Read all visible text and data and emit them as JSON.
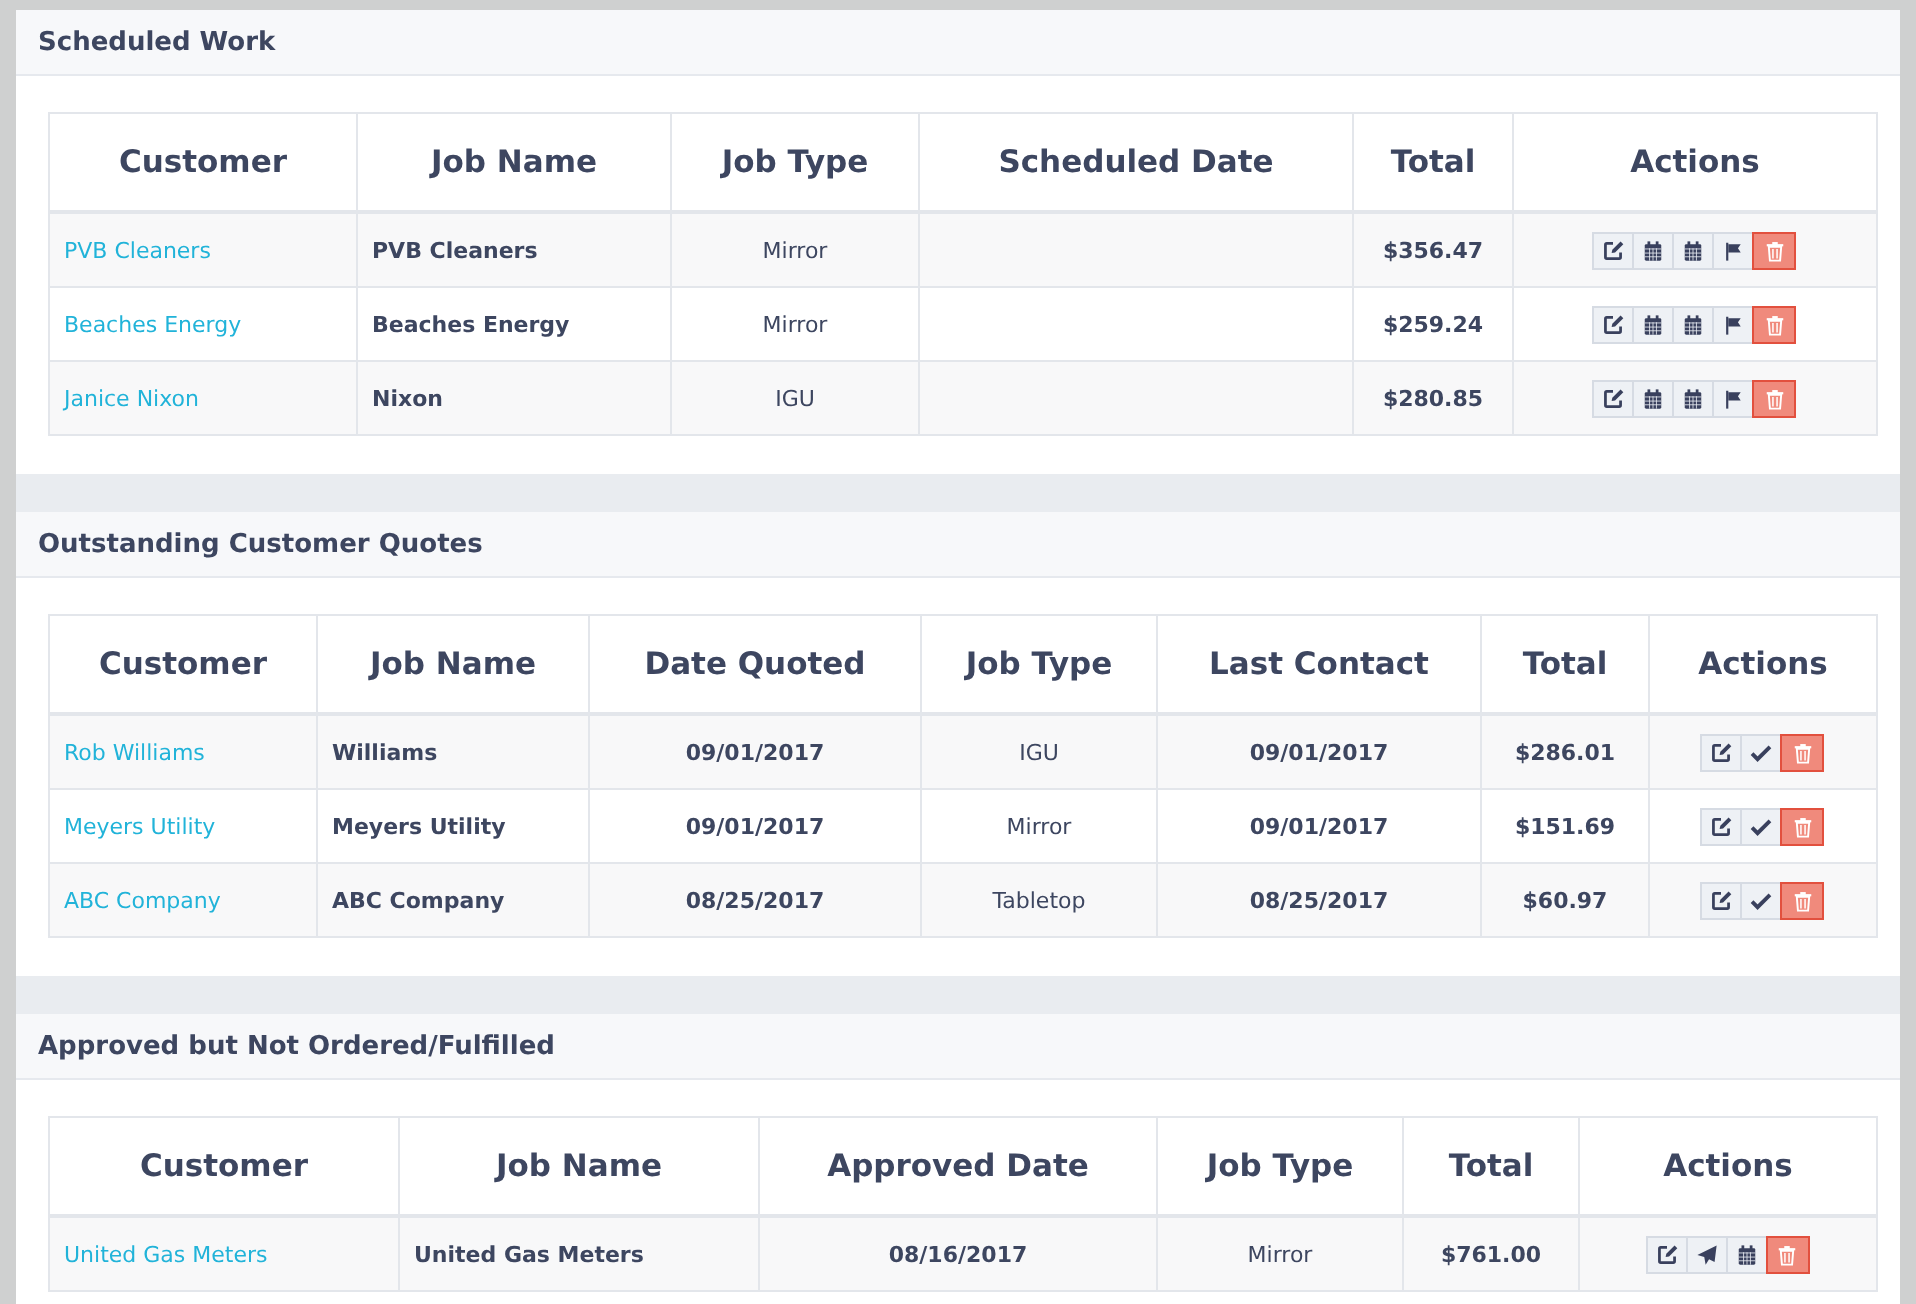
{
  "sections": [
    {
      "title": "Scheduled Work",
      "columns": [
        {
          "label": "Customer",
          "kind": "link"
        },
        {
          "label": "Job Name",
          "kind": "bold"
        },
        {
          "label": "Job Type",
          "kind": "text"
        },
        {
          "label": "Scheduled Date",
          "kind": "date"
        },
        {
          "label": "Total",
          "kind": "money"
        },
        {
          "label": "Actions",
          "kind": "actions"
        }
      ],
      "rows": [
        {
          "cells": [
            "PVB Cleaners",
            "PVB Cleaners",
            "Mirror",
            "",
            "$356.47"
          ],
          "actions": [
            {
              "kind": "edit"
            },
            {
              "kind": "calendar"
            },
            {
              "kind": "calendar"
            },
            {
              "kind": "flag"
            },
            {
              "kind": "delete"
            }
          ]
        },
        {
          "cells": [
            "Beaches Energy",
            "Beaches Energy",
            "Mirror",
            "",
            "$259.24"
          ],
          "actions": [
            {
              "kind": "edit"
            },
            {
              "kind": "calendar"
            },
            {
              "kind": "calendar"
            },
            {
              "kind": "flag"
            },
            {
              "kind": "delete"
            }
          ]
        },
        {
          "cells": [
            "Janice Nixon",
            "Nixon",
            "IGU",
            "",
            "$280.85"
          ],
          "actions": [
            {
              "kind": "edit"
            },
            {
              "kind": "calendar"
            },
            {
              "kind": "calendar"
            },
            {
              "kind": "flag"
            },
            {
              "kind": "delete"
            }
          ]
        }
      ]
    },
    {
      "title": "Outstanding Customer Quotes",
      "columns": [
        {
          "label": "Customer",
          "kind": "link"
        },
        {
          "label": "Job Name",
          "kind": "bold"
        },
        {
          "label": "Date Quoted",
          "kind": "date"
        },
        {
          "label": "Job Type",
          "kind": "text"
        },
        {
          "label": "Last Contact",
          "kind": "date"
        },
        {
          "label": "Total",
          "kind": "money"
        },
        {
          "label": "Actions",
          "kind": "actions"
        }
      ],
      "rows": [
        {
          "cells": [
            "Rob Williams",
            "Williams",
            "09/01/2017",
            "IGU",
            "09/01/2017",
            "$286.01"
          ],
          "actions": [
            {
              "kind": "edit"
            },
            {
              "kind": "check"
            },
            {
              "kind": "delete"
            }
          ]
        },
        {
          "cells": [
            "Meyers Utility",
            "Meyers Utility",
            "09/01/2017",
            "Mirror",
            "09/01/2017",
            "$151.69"
          ],
          "actions": [
            {
              "kind": "edit"
            },
            {
              "kind": "check"
            },
            {
              "kind": "delete"
            }
          ]
        },
        {
          "cells": [
            "ABC Company",
            "ABC Company",
            "08/25/2017",
            "Tabletop",
            "08/25/2017",
            "$60.97"
          ],
          "actions": [
            {
              "kind": "edit"
            },
            {
              "kind": "check"
            },
            {
              "kind": "delete"
            }
          ]
        }
      ]
    },
    {
      "title": "Approved but Not Ordered/Fulfilled",
      "columns": [
        {
          "label": "Customer",
          "kind": "link"
        },
        {
          "label": "Job Name",
          "kind": "bold"
        },
        {
          "label": "Approved Date",
          "kind": "date"
        },
        {
          "label": "Job Type",
          "kind": "text"
        },
        {
          "label": "Total",
          "kind": "money"
        },
        {
          "label": "Actions",
          "kind": "actions"
        }
      ],
      "rows": [
        {
          "cells": [
            "United Gas Meters",
            "United Gas Meters",
            "08/16/2017",
            "Mirror",
            "$761.00"
          ],
          "actions": [
            {
              "kind": "edit"
            },
            {
              "kind": "send"
            },
            {
              "kind": "calendar"
            },
            {
              "kind": "delete"
            }
          ]
        }
      ]
    }
  ]
}
